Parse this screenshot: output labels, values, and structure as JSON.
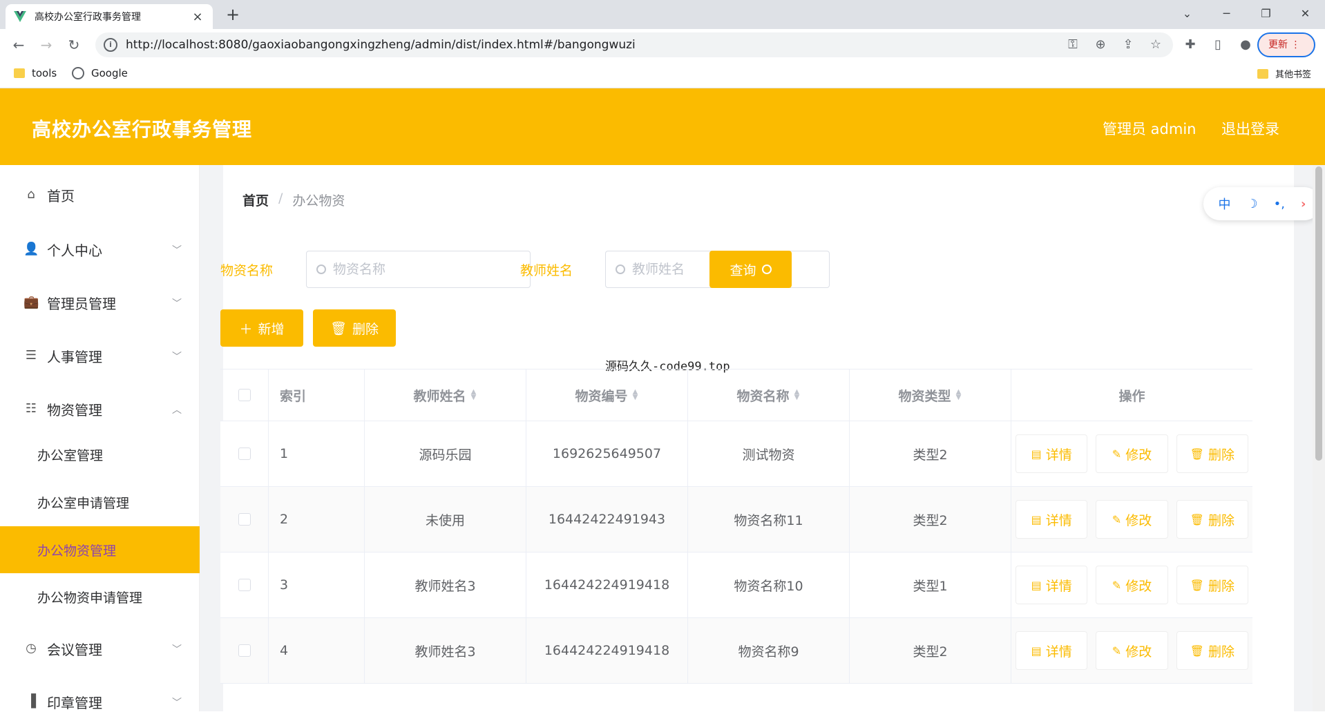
{
  "browser": {
    "tab_title": "高校办公室行政事务管理",
    "new_tab": "+",
    "url": "http://localhost:8080/gaoxiaobangongxingzheng/admin/dist/index.html#/bangongwuzi",
    "update_label": "更新",
    "bookmarks": [
      "tools",
      "Google"
    ],
    "other_bookmarks": "其他书签"
  },
  "header": {
    "title": "高校办公室行政事务管理",
    "user": "管理员 admin",
    "logout": "退出登录"
  },
  "sidebar": {
    "items": [
      {
        "label": "首页",
        "icon": "home-icon"
      },
      {
        "label": "个人中心",
        "icon": "user-icon"
      },
      {
        "label": "管理员管理",
        "icon": "briefcase-icon"
      },
      {
        "label": "人事管理",
        "icon": "list-icon"
      },
      {
        "label": "物资管理",
        "icon": "sliders-icon"
      },
      {
        "label": "会议管理",
        "icon": "compass-icon"
      },
      {
        "label": "印章管理",
        "icon": "bar-chart-icon"
      }
    ],
    "subitems": [
      "办公室管理",
      "办公室申请管理",
      "办公物资管理",
      "办公物资申请管理"
    ],
    "active_subitem": "办公物资管理"
  },
  "breadcrumb": {
    "home": "首页",
    "separator": "/",
    "current": "办公物资"
  },
  "float_tool": [
    "中",
    "☽",
    "•,",
    "›"
  ],
  "filters": {
    "name_label": "物资名称",
    "name_placeholder": "物资名称",
    "teacher_label": "教师姓名",
    "teacher_placeholder": "教师姓名",
    "search_label": "查询"
  },
  "actions": {
    "add": "新增",
    "delete": "删除"
  },
  "source_note": "源码久久-code99.top",
  "table": {
    "columns": [
      "索引",
      "教师姓名",
      "物资编号",
      "物资名称",
      "物资类型",
      "操作"
    ],
    "row_buttons": {
      "detail": "详情",
      "edit": "修改",
      "delete": "删除"
    },
    "rows": [
      {
        "index": "1",
        "teacher": "源码乐园",
        "code": "1692625649507",
        "name": "测试物资",
        "type": "类型2"
      },
      {
        "index": "2",
        "teacher": "未使用",
        "code": "16442422491943",
        "name": "物资名称11",
        "type": "类型2"
      },
      {
        "index": "3",
        "teacher": "教师姓名3",
        "code": "164424224919418",
        "name": "物资名称10",
        "type": "类型1"
      },
      {
        "index": "4",
        "teacher": "教师姓名3",
        "code": "164424224919418",
        "name": "物资名称9",
        "type": "类型2"
      }
    ]
  },
  "colors": {
    "accent": "#fbbb00",
    "active_text": "#8e44ad"
  }
}
